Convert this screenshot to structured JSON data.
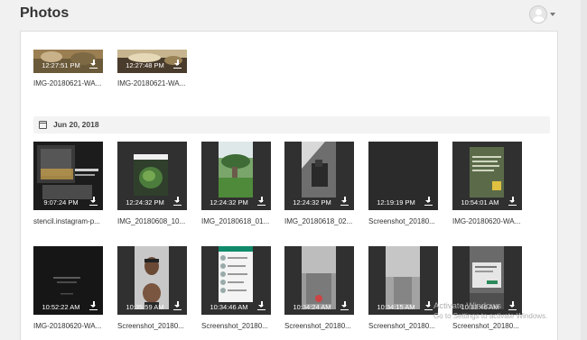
{
  "app": {
    "title": "Photos"
  },
  "user": {
    "avatar_icon": "user-avatar-icon",
    "menu_icon": "caret-down-icon"
  },
  "recent": [
    {
      "time": "12:27:51 PM",
      "name": "IMG-20180621-WA..."
    },
    {
      "time": "12:27:48 PM",
      "name": "IMG-20180621-WA..."
    }
  ],
  "group": {
    "date": "Jun 20, 2018",
    "icon": "calendar-icon"
  },
  "row1": [
    {
      "time": "9:07:24 PM",
      "name": "stencil.instagram-p..."
    },
    {
      "time": "12:24:32 PM",
      "name": "IMG_20180608_10..."
    },
    {
      "time": "12:24:32 PM",
      "name": "IMG_20180618_01..."
    },
    {
      "time": "12:24:32 PM",
      "name": "IMG_20180618_02..."
    },
    {
      "time": "12:19:19 PM",
      "name": "Screenshot_20180..."
    },
    {
      "time": "10:54:01 AM",
      "name": "IMG-20180620-WA..."
    }
  ],
  "row2": [
    {
      "time": "10:52:22 AM",
      "name": "IMG-20180620-WA..."
    },
    {
      "time": "10:35:59 AM",
      "name": "Screenshot_20180..."
    },
    {
      "time": "10:34:46 AM",
      "name": "Screenshot_20180..."
    },
    {
      "time": "10:34:24 AM",
      "name": "Screenshot_20180..."
    },
    {
      "time": "10:34:15 AM",
      "name": "Screenshot_20180..."
    },
    {
      "time": "10:33:46 AM",
      "name": "Screenshot_20180..."
    }
  ],
  "watermark": {
    "line1": "Activate Windows",
    "line2": "Go to Settings to activate Windows."
  },
  "icons": {
    "download": "download-icon"
  },
  "colors": {
    "tile_bg": "#303030",
    "panel_bg": "#ffffff",
    "page_bg": "#f1f1f1"
  }
}
